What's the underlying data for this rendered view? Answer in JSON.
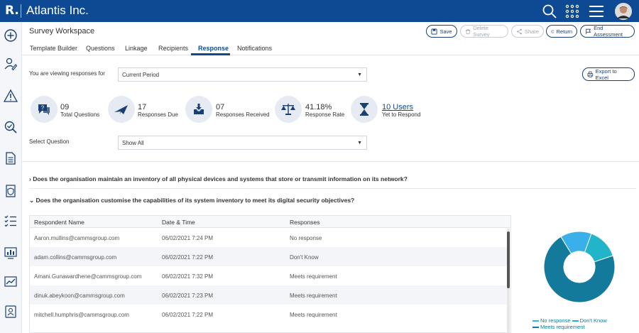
{
  "app": {
    "logo": "R.",
    "title": "Atlantis Inc."
  },
  "header": {
    "workspace_title": "Survey Workspace",
    "buttons": {
      "save": "Save",
      "delete_survey": "Delete Survey",
      "share": "Share",
      "return": "Return",
      "end_assessment": "End Assessment"
    }
  },
  "tabs": [
    "Template Builder",
    "Questions",
    "Linkage",
    "Recipients",
    "Response",
    "Notifications"
  ],
  "active_tab": "Response",
  "viewing": {
    "label": "You are viewing responses for",
    "period": "Current Period"
  },
  "export_label": "Export to Excel",
  "stats": [
    {
      "num": "09",
      "label": "Total Questions",
      "icon": "chat-question-icon"
    },
    {
      "num": "17",
      "label": "Responses Due",
      "icon": "paper-plane-icon"
    },
    {
      "num": "07",
      "label": "Responses Received",
      "icon": "inbox-download-icon"
    },
    {
      "num": "41.18%",
      "label": "Response Rate",
      "icon": "balance-scale-icon"
    },
    {
      "num": "10 Users",
      "label": "Yet to Respond",
      "icon": "hourglass-icon"
    }
  ],
  "select_question": {
    "label": "Select Question",
    "value": "Show All"
  },
  "questions": [
    {
      "expanded": false,
      "text": "Does the organisation maintain an inventory of all physical devices and systems that store or transmit information on its network?"
    },
    {
      "expanded": true,
      "text": "Does the organisation customise the capabilities of its system inventory to meet its digital security objectives?"
    }
  ],
  "table": {
    "headers": [
      "Respondent Name",
      "Date & Time",
      "Responses"
    ],
    "rows": [
      [
        "Aaron.mullins@cammsgroup.com",
        "06/02/2021 7:24 PM",
        "No response"
      ],
      [
        "adam.collins@cammsgroup.com",
        "06/02/2021 7:22 PM",
        "Don't Know"
      ],
      [
        "Amani.Gunawardhene@cammsgroup.com",
        "06/02/2021 7:32 PM",
        "Meets requirement"
      ],
      [
        "dinuk.abeykoon@cammsgroup.com",
        "06/02/2021 7:23 PM",
        "Meets requirement"
      ],
      [
        "mitchell.humphris@cammsgroup.com",
        "06/02/2021 7:22 PM",
        "Meets requirement"
      ]
    ]
  },
  "chart_data": {
    "type": "pie",
    "donut": true,
    "categories": [
      "No response",
      "Don't Know",
      "Meets requirement"
    ],
    "values": [
      1,
      1,
      5
    ],
    "colors": [
      "#3ab0ea",
      "#22b5c9",
      "#147a9c"
    ],
    "legend_placement": "bottom"
  },
  "colors": {
    "brand": "#0d4a93",
    "accent_light": "#e6ebf3"
  }
}
